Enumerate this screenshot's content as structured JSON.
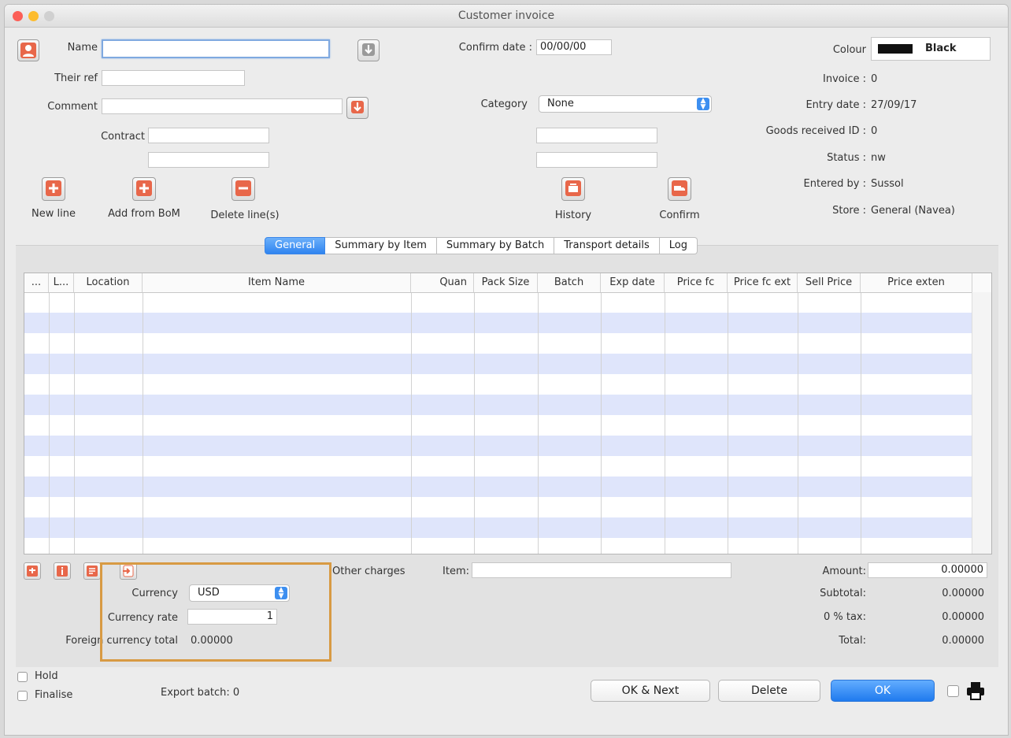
{
  "window": {
    "title": "Customer invoice"
  },
  "header": {
    "name_label": "Name",
    "name_value": "",
    "their_ref_label": "Their ref",
    "their_ref_value": "",
    "comment_label": "Comment",
    "comment_value": "",
    "contract_label": "Contract",
    "contract_value": "",
    "contract_value2": "",
    "confirm_date_label": "Confirm date :",
    "confirm_date_value": "00/00/00",
    "category_label": "Category",
    "category_value": "None",
    "extra_field1": "",
    "extra_field2": ""
  },
  "toolbar": {
    "new_line": "New line",
    "add_from_bom": "Add from BoM",
    "delete_lines": "Delete line(s)",
    "history": "History",
    "confirm": "Confirm"
  },
  "info": {
    "colour_label": "Colour",
    "colour_value": "Black",
    "colour_swatch": "#111111",
    "invoice_label": "Invoice :",
    "invoice_value": "0",
    "entry_date_label": "Entry date :",
    "entry_date_value": "27/09/17",
    "goods_received_label": "Goods received ID :",
    "goods_received_value": "0",
    "status_label": "Status :",
    "status_value": "nw",
    "entered_by_label": "Entered by :",
    "entered_by_value": "Sussol",
    "store_label": "Store :",
    "store_value": "General (Navea)"
  },
  "tabs": [
    "General",
    "Summary by Item",
    "Summary by Batch",
    "Transport details",
    "Log"
  ],
  "table": {
    "columns": [
      "...",
      "L...",
      "Location",
      "Item Name",
      "Quan",
      "Pack Size",
      "Batch",
      "Exp date",
      "Price fc",
      "Price fc ext",
      "Sell Price",
      "Price exten"
    ],
    "rows": []
  },
  "currency": {
    "currency_label": "Currency",
    "currency_value": "USD",
    "rate_label": "Currency rate",
    "rate_value": "1",
    "foreign_total_label": "Foreign currency total",
    "foreign_total_value": "0.00000"
  },
  "charges": {
    "other_charges_label": "Other charges",
    "item_label": "Item:",
    "item_value": ""
  },
  "totals": {
    "amount_label": "Amount:",
    "amount_value": "0.00000",
    "subtotal_label": "Subtotal:",
    "subtotal_value": "0.00000",
    "tax_label": "0 % tax:",
    "tax_value": "0.00000",
    "total_label": "Total:",
    "total_value": "0.00000"
  },
  "footer": {
    "hold_label": "Hold",
    "finalise_label": "Finalise",
    "export_batch": "Export batch: 0",
    "ok_next": "OK & Next",
    "delete": "Delete",
    "ok": "OK"
  },
  "colors": {
    "accent": "#2f84f0",
    "row_alt": "#dfe5fb",
    "highlight_box": "#d89a43"
  }
}
